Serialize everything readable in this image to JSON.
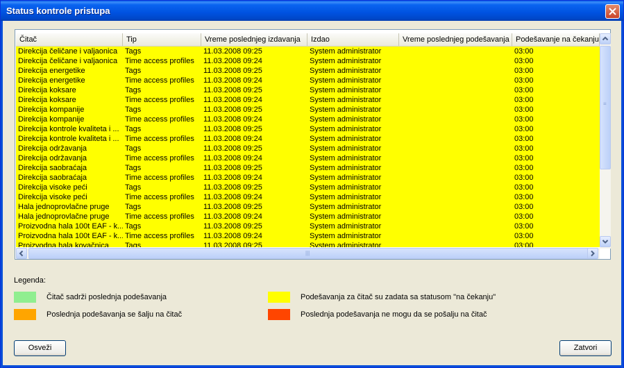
{
  "window": {
    "title": "Status kontrole pristupa"
  },
  "table": {
    "columns": [
      "Čitač",
      "Tip",
      "Vreme poslednjeg izdavanja",
      "Izdao",
      "Vreme poslednjeg podešavanja",
      "Podešavanje na čekanju"
    ],
    "rows": [
      [
        "Direkcija čeličane i valjaonica",
        "Tags",
        "11.03.2008    09:25",
        "System administrator",
        "",
        "03:00"
      ],
      [
        "Direkcija čeličane i valjaonica",
        "Time access profiles",
        "11.03.2008    09:24",
        "System administrator",
        "",
        "03:00"
      ],
      [
        "Direkcija energetike",
        "Tags",
        "11.03.2008    09:25",
        "System administrator",
        "",
        "03:00"
      ],
      [
        "Direkcija energetike",
        "Time access profiles",
        "11.03.2008    09:24",
        "System administrator",
        "",
        "03:00"
      ],
      [
        "Direkcija koksare",
        "Tags",
        "11.03.2008    09:25",
        "System administrator",
        "",
        "03:00"
      ],
      [
        "Direkcija koksare",
        "Time access profiles",
        "11.03.2008    09:24",
        "System administrator",
        "",
        "03:00"
      ],
      [
        "Direkcija kompanije",
        "Tags",
        "11.03.2008    09:25",
        "System administrator",
        "",
        "03:00"
      ],
      [
        "Direkcija kompanije",
        "Time access profiles",
        "11.03.2008    09:24",
        "System administrator",
        "",
        "03:00"
      ],
      [
        "Direkcija kontrole kvaliteta i ...",
        "Tags",
        "11.03.2008    09:25",
        "System administrator",
        "",
        "03:00"
      ],
      [
        "Direkcija kontrole kvaliteta i ...",
        "Time access profiles",
        "11.03.2008    09:24",
        "System administrator",
        "",
        "03:00"
      ],
      [
        "Direkcija održavanja",
        "Tags",
        "11.03.2008    09:25",
        "System administrator",
        "",
        "03:00"
      ],
      [
        "Direkcija održavanja",
        "Time access profiles",
        "11.03.2008    09:24",
        "System administrator",
        "",
        "03:00"
      ],
      [
        "Direkcija saobraćaja",
        "Tags",
        "11.03.2008    09:25",
        "System administrator",
        "",
        "03:00"
      ],
      [
        "Direkcija saobraćaja",
        "Time access profiles",
        "11.03.2008    09:24",
        "System administrator",
        "",
        "03:00"
      ],
      [
        "Direkcija visoke peći",
        "Tags",
        "11.03.2008    09:25",
        "System administrator",
        "",
        "03:00"
      ],
      [
        "Direkcija visoke peći",
        "Time access profiles",
        "11.03.2008    09:24",
        "System administrator",
        "",
        "03:00"
      ],
      [
        "Hala jednoprovlačne pruge",
        "Tags",
        "11.03.2008    09:25",
        "System administrator",
        "",
        "03:00"
      ],
      [
        "Hala jednoprovlačne pruge",
        "Time access profiles",
        "11.03.2008    09:24",
        "System administrator",
        "",
        "03:00"
      ],
      [
        "Proizvodna hala 100t EAF - k...",
        "Tags",
        "11.03.2008    09:25",
        "System administrator",
        "",
        "03:00"
      ],
      [
        "Proizvodna hala 100t EAF - k...",
        "Time access profiles",
        "11.03.2008    09:24",
        "System administrator",
        "",
        "03:00"
      ],
      [
        "Proizvodna hala kovačnica",
        "Tags",
        "11.03.2008    09:25",
        "System administrator",
        "",
        "03:00"
      ]
    ],
    "row_color": "#ffff00"
  },
  "legend": {
    "title": "Legenda:",
    "items": [
      {
        "color": "#90ee90",
        "label": "Čitač sadrži poslednja podešavanja"
      },
      {
        "color": "#ffff00",
        "label": "Podešavanja za čitač su zadata sa statusom \"na čekanju\""
      },
      {
        "color": "#ffa500",
        "label": "Poslednja podešavanja se šalju na čitač"
      },
      {
        "color": "#ff4500",
        "label": "Poslednja podešavanja ne mogu da se pošalju na čitač"
      }
    ]
  },
  "buttons": {
    "refresh": "Osveži",
    "close": "Zatvori"
  },
  "icons": {
    "close": "close-icon",
    "scroll_up": "arrow-up-icon",
    "scroll_down": "arrow-down-icon",
    "scroll_left": "arrow-left-icon",
    "scroll_right": "arrow-right-icon"
  }
}
